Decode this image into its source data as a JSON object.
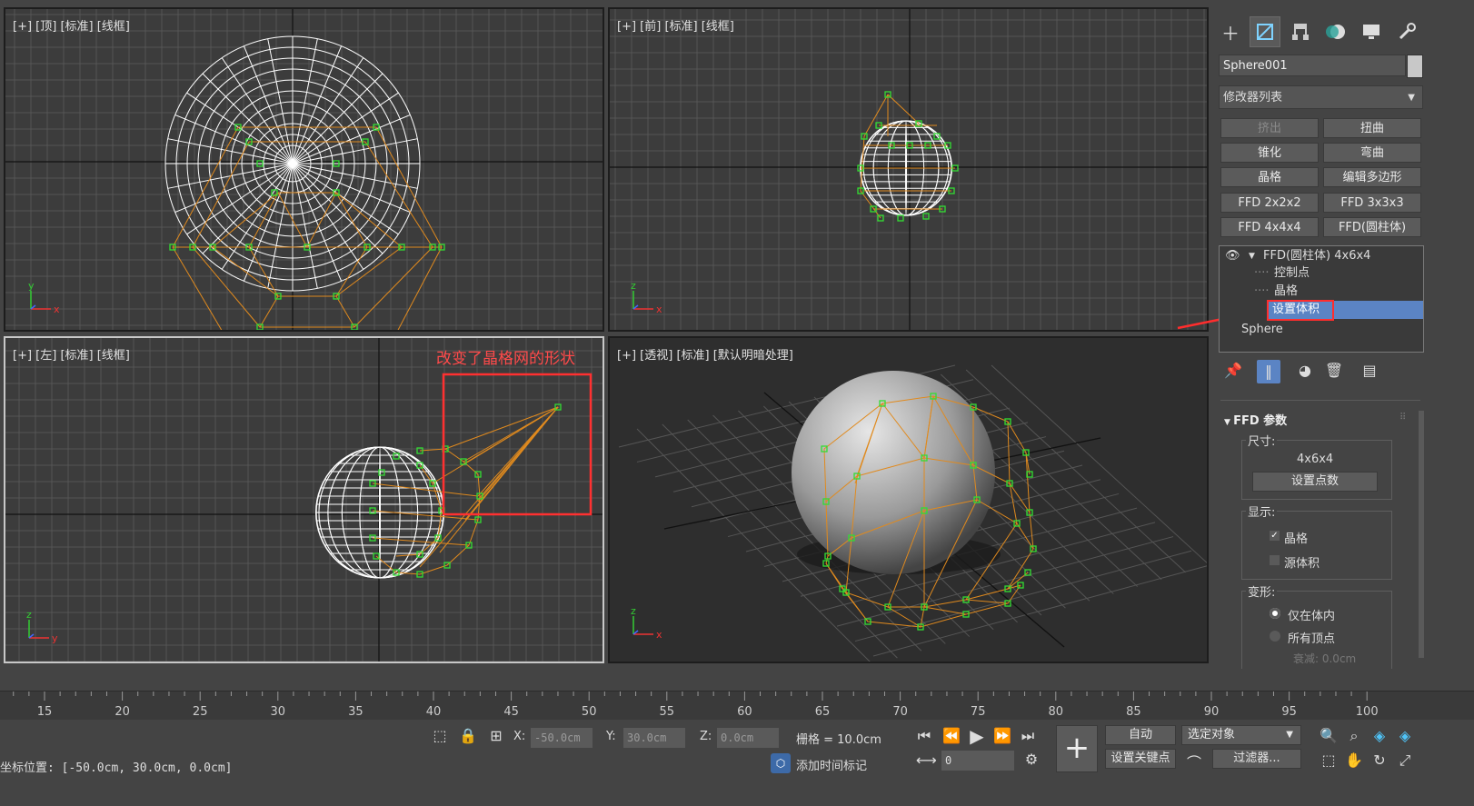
{
  "viewports": {
    "top": {
      "label": "[+] [顶] [标准] [线框]"
    },
    "front": {
      "label": "[+] [前] [标准] [线框]"
    },
    "left": {
      "label": "[+] [左] [标准] [线框]",
      "annotation": "改变了晶格网的形状"
    },
    "perspective": {
      "label": "[+] [透视] [标准] [默认明暗处理]"
    }
  },
  "command_panel": {
    "tab_icons": [
      "create-icon",
      "modify-icon",
      "hierarchy-icon",
      "motion-icon",
      "display-icon",
      "utilities-icon"
    ],
    "object_name": "Sphere001",
    "modifier_list": "修改器列表",
    "modifier_buttons": [
      "挤出",
      "扭曲",
      "锥化",
      "弯曲",
      "晶格",
      "编辑多边形",
      "FFD 2x2x2",
      "FFD 3x3x3",
      "FFD 4x4x4",
      "FFD(圆柱体)"
    ],
    "stack": {
      "modifier": "FFD(圆柱体) 4x6x4",
      "sub1": "控制点",
      "sub2": "晶格",
      "sub3": "设置体积",
      "base": "Sphere"
    },
    "rollout": {
      "title": "FFD 参数",
      "dimensions_label": "尺寸:",
      "dimensions_value": "4x6x4",
      "set_points_button": "设置点数",
      "display_label": "显示:",
      "lattice_checkbox": "晶格",
      "source_volume_checkbox": "源体积",
      "deform_label": "变形:",
      "only_in_volume": "仅在体内",
      "all_vertices": "所有顶点",
      "falloff_partial": "衰减: 0.0cm"
    }
  },
  "timeline": {
    "ticks": [
      "15",
      "20",
      "25",
      "30",
      "35",
      "40",
      "45",
      "50",
      "55",
      "60",
      "65",
      "70",
      "75",
      "80",
      "85",
      "90",
      "95",
      "100"
    ]
  },
  "status": {
    "coord_position": "坐标位置: [-50.0cm, 30.0cm, 0.0cm]",
    "x_label": "X:",
    "x_value": "-50.0cm",
    "y_label": "Y:",
    "y_value": "30.0cm",
    "z_label": "Z:",
    "z_value": "0.0cm",
    "grid": "栅格 = 10.0cm",
    "add_time_tag": "添加时间标记",
    "auto_key": "自动",
    "set_key": "设置关键点",
    "selected_object": "选定对象",
    "filters": "过滤器...",
    "frame_value": "0"
  },
  "colors": {
    "lattice": "#e08a1e",
    "control_point": "#33dd33",
    "wire": "#ffffff",
    "annotation": "#ff3030",
    "highlight": "#5b84c4"
  }
}
